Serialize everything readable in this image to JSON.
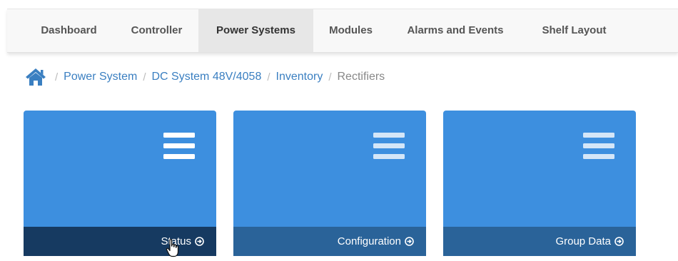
{
  "nav": {
    "tabs": [
      {
        "label": "Dashboard"
      },
      {
        "label": "Controller"
      },
      {
        "label": "Power Systems",
        "active": true
      },
      {
        "label": "Modules"
      },
      {
        "label": "Alarms and Events"
      },
      {
        "label": "Shelf Layout"
      }
    ]
  },
  "breadcrumb": {
    "home_icon": "home-icon",
    "items": [
      {
        "label": "Power System",
        "link": true
      },
      {
        "label": "DC System 48V/4058",
        "link": true
      },
      {
        "label": "Inventory",
        "link": true
      },
      {
        "label": "Rectifiers",
        "link": false
      }
    ],
    "separator": "/"
  },
  "cards": [
    {
      "label": "Status",
      "icon": "menu-icon",
      "footer_icon": "circle-arrow-right-icon",
      "selected": true
    },
    {
      "label": "Configuration",
      "icon": "menu-icon",
      "footer_icon": "circle-arrow-right-icon"
    },
    {
      "label": "Group Data",
      "icon": "menu-icon",
      "footer_icon": "circle-arrow-right-icon"
    }
  ],
  "colors": {
    "card_bg": "#3d8fdf",
    "card_footer": "#2a6399",
    "card_footer_selected": "#163a61",
    "link": "#3a7fc1",
    "nav_active_bg": "#e7e7e7"
  }
}
